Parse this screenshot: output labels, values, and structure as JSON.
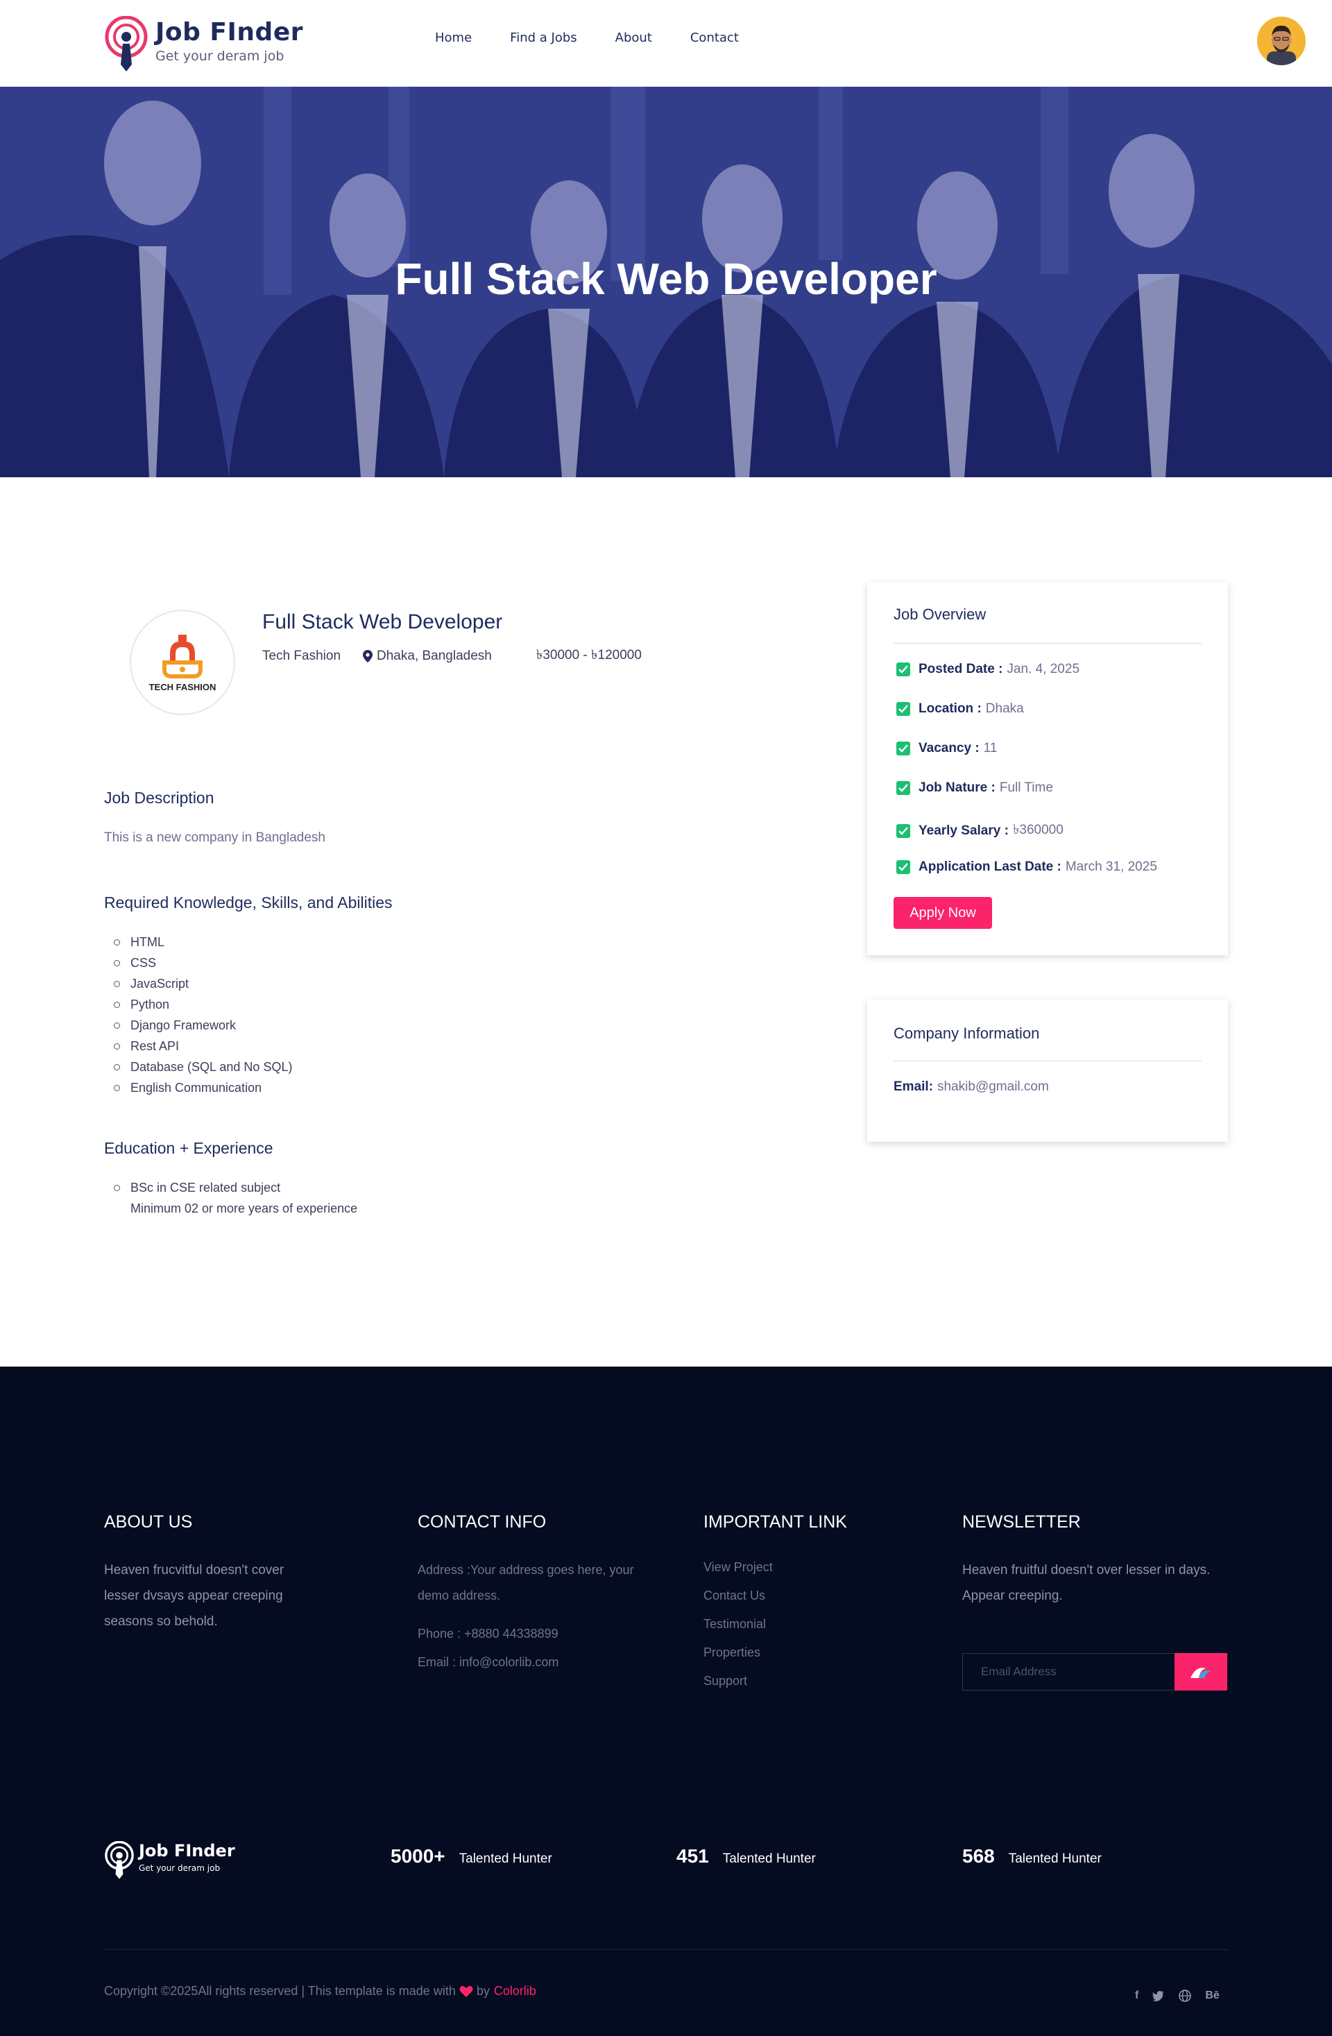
{
  "header": {
    "logo_title": "Job FInder",
    "logo_subtitle": "Get your deram job",
    "nav": [
      "Home",
      "Find a Jobs",
      "About",
      "Contact"
    ]
  },
  "hero": {
    "title": "Full Stack Web Developer"
  },
  "job": {
    "company_logo_text": "TECH FASHION",
    "title": "Full Stack Web Developer",
    "company": "Tech Fashion",
    "location": "Dhaka, Bangladesh",
    "salary": "৳30000 - ৳120000"
  },
  "description": {
    "title": "Job Description",
    "text": "This is a new company in Bangladesh"
  },
  "skills": {
    "title": "Required Knowledge, Skills, and Abilities",
    "items": [
      "HTML",
      "CSS",
      "JavaScript",
      "Python",
      "Django Framework",
      "Rest API",
      "Database (SQL and No SQL)",
      "English Communication"
    ]
  },
  "education": {
    "title": "Education + Experience",
    "items": [
      "BSc in CSE related subject",
      "Minimum 02 or more years of experience"
    ]
  },
  "overview": {
    "title": "Job Overview",
    "items": [
      {
        "label": "Posted Date :",
        "value": "Jan. 4, 2025"
      },
      {
        "label": "Location :",
        "value": "Dhaka"
      },
      {
        "label": "Vacancy :",
        "value": "11"
      },
      {
        "label": "Job Nature :",
        "value": "Full Time"
      },
      {
        "label": "Yearly Salary :",
        "value": "৳360000"
      },
      {
        "label": "Application Last Date :",
        "value": "March 31, 2025"
      }
    ],
    "apply_label": "Apply Now"
  },
  "company_info": {
    "title": "Company Information",
    "email_label": "Email:",
    "email_value": "shakib@gmail.com"
  },
  "footer": {
    "about": {
      "title": "ABOUT US",
      "text": "Heaven frucvitful doesn't cover lesser dvsays appear creeping seasons so behold."
    },
    "contact": {
      "title": "CONTACT INFO",
      "address": "Address :Your address goes here, your demo address.",
      "phone": "Phone : +8880 44338899",
      "email": "Email : info@colorlib.com"
    },
    "links": {
      "title": "IMPORTANT LINK",
      "items": [
        "View Project",
        "Contact Us",
        "Testimonial",
        "Properties",
        "Support"
      ]
    },
    "newsletter": {
      "title": "NEWSLETTER",
      "text": "Heaven fruitful doesn't over lesser in days. Appear creeping.",
      "placeholder": "Email Address"
    },
    "logo_title": "Job FInder",
    "logo_subtitle": "Get your deram job",
    "stats": [
      {
        "num": "5000+",
        "label": "Talented Hunter"
      },
      {
        "num": "451",
        "label": "Talented Hunter"
      },
      {
        "num": "568",
        "label": "Talented Hunter"
      }
    ],
    "copyright_pre": "Copyright ©2025All rights reserved | This template is made with",
    "copyright_by": "by",
    "copyright_brand": "Colorlib",
    "socials": [
      "f",
      "twitter",
      "globe",
      "Bē"
    ]
  },
  "colors": {
    "accent": "#fb246a",
    "navy": "#1f2b5e",
    "footer_bg": "#050b20",
    "hero_overlay": "#2f3a86",
    "check": "#1bbf72"
  }
}
